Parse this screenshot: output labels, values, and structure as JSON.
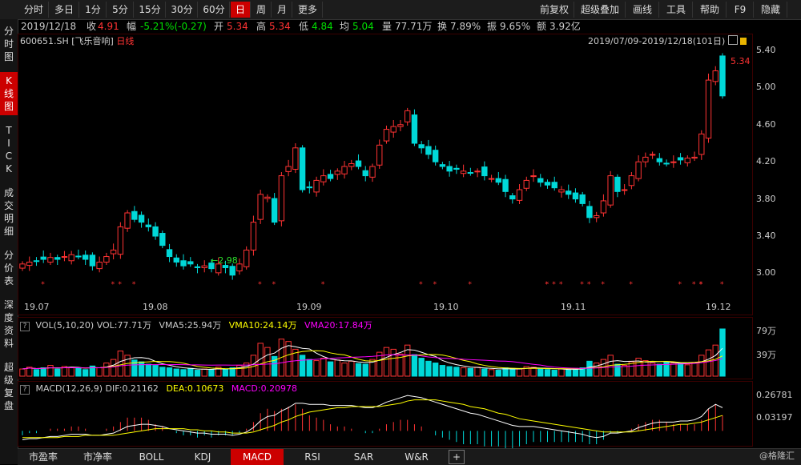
{
  "toolbar": {
    "left": [
      "分时",
      "多日",
      "1分",
      "5分",
      "15分",
      "30分",
      "60分",
      "日",
      "周",
      "月",
      "更多"
    ],
    "active": "日",
    "right": [
      "前复权",
      "超级叠加",
      "画线",
      "工具",
      "帮助",
      "F9",
      "隐藏"
    ]
  },
  "quote": {
    "date": "2019/12/18",
    "close_label": "收",
    "close": "4.91",
    "change_label": "幅",
    "change": "-5.21%(-0.27)",
    "open_label": "开",
    "open": "5.34",
    "high_label": "高",
    "high": "5.34",
    "low_label": "低",
    "low": "4.84",
    "avg_label": "均",
    "avg": "5.04",
    "volume_label": "量",
    "volume": "77.71万",
    "turnover_label": "换",
    "turnover": "7.89%",
    "amplitude_label": "振",
    "amplitude": "9.65%",
    "amount_label": "额",
    "amount": "3.92亿"
  },
  "security": {
    "code": "600651.SH",
    "name": "[飞乐音响]",
    "period": "日线"
  },
  "range_label": "2019/07/09-2019/12/18(101日)",
  "sidebar": [
    "分时图",
    "K线图",
    "TICK",
    "成交明细",
    "分价表",
    "深度资料",
    "超级复盘"
  ],
  "sidebar_active": 1,
  "price_axis": [
    "5.40",
    "5.00",
    "4.60",
    "4.20",
    "3.80",
    "3.40",
    "3.00"
  ],
  "volume_axis": [
    "79万",
    "39万"
  ],
  "macd_axis": [
    "0.26781",
    "0.03197"
  ],
  "x_axis": [
    "19.07",
    "19.08",
    "19.09",
    "19.10",
    "19.11",
    "19.12"
  ],
  "annotations": {
    "high": "5.34",
    "low": "2.98"
  },
  "vol_indicator": {
    "title": "VOL(5,10,20)",
    "vol": "VOL:77.71万",
    "vma5": "VMA5:25.94万",
    "vma10": "VMA10:24.14万",
    "vma20": "VMA20:17.84万"
  },
  "macd_indicator": {
    "title": "MACD(12,26,9)",
    "dif": "DIF:0.21162",
    "dea": "DEA:0.10673",
    "macd": "MACD:0.20978"
  },
  "bottom_tabs": [
    "市盈率",
    "市净率",
    "BOLL",
    "KDJ",
    "MACD",
    "RSI",
    "SAR",
    "W&R"
  ],
  "bottom_active": "MACD",
  "watermark": "@格隆汇",
  "colors": {
    "up": "#ff3333",
    "down": "#00d8d8",
    "active": "#cc0000",
    "vma5": "#ffffff",
    "vma10": "#ffff00",
    "vma20": "#ff00ff"
  },
  "chart_data": {
    "type": "candlestick",
    "closes": [
      3.1,
      3.12,
      3.13,
      3.15,
      3.17,
      3.15,
      3.18,
      3.2,
      3.18,
      3.15,
      3.08,
      3.12,
      3.18,
      3.25,
      3.5,
      3.65,
      3.58,
      3.55,
      3.5,
      3.4,
      3.3,
      3.18,
      3.12,
      3.08,
      3.1,
      3.06,
      3.08,
      3.05,
      3.1,
      3.06,
      2.98,
      3.1,
      3.25,
      3.55,
      3.85,
      3.82,
      3.55,
      4.05,
      4.15,
      4.35,
      3.9,
      3.92,
      4.0,
      4.05,
      4.02,
      4.1,
      4.15,
      4.18,
      4.15,
      4.05,
      4.15,
      4.38,
      4.55,
      4.58,
      4.6,
      4.75,
      4.4,
      4.35,
      4.28,
      4.2,
      4.15,
      4.1,
      4.12,
      4.1,
      4.08,
      4.1,
      4.05,
      4.02,
      3.98,
      3.88,
      3.8,
      3.9,
      4.0,
      4.05,
      3.98,
      3.95,
      3.92,
      3.9,
      3.85,
      3.8,
      3.75,
      3.6,
      3.62,
      3.78,
      4.05,
      3.88,
      3.9,
      4.05,
      4.2,
      4.25,
      4.28,
      4.2,
      4.18,
      4.2,
      4.22,
      4.24,
      4.25,
      4.5,
      5.08,
      5.18,
      4.91
    ],
    "volumes": [
      12,
      15,
      11,
      14,
      18,
      12,
      16,
      15,
      13,
      11,
      17,
      14,
      22,
      28,
      42,
      35,
      27,
      24,
      20,
      18,
      15,
      14,
      12,
      11,
      13,
      10,
      12,
      11,
      15,
      12,
      14,
      18,
      22,
      35,
      55,
      48,
      33,
      62,
      58,
      45,
      35,
      28,
      26,
      30,
      24,
      27,
      22,
      25,
      21,
      20,
      28,
      40,
      48,
      45,
      37,
      52,
      36,
      30,
      25,
      22,
      18,
      16,
      15,
      14,
      13,
      15,
      12,
      11,
      10,
      14,
      13,
      12,
      16,
      15,
      12,
      11,
      10,
      12,
      11,
      13,
      14,
      25,
      22,
      28,
      35,
      20,
      18,
      24,
      30,
      26,
      22,
      20,
      24,
      22,
      21,
      19,
      23,
      35,
      44,
      52,
      79
    ],
    "price_range": [
      2.84,
      5.46
    ],
    "dif": [
      -0.08,
      -0.07,
      -0.07,
      -0.06,
      -0.05,
      -0.05,
      -0.04,
      -0.03,
      -0.03,
      -0.03,
      -0.04,
      -0.04,
      -0.03,
      -0.02,
      0.01,
      0.04,
      0.05,
      0.06,
      0.06,
      0.05,
      0.04,
      0.02,
      0.01,
      0.0,
      -0.01,
      -0.02,
      -0.02,
      -0.03,
      -0.03,
      -0.03,
      -0.04,
      -0.03,
      -0.01,
      0.03,
      0.09,
      0.13,
      0.14,
      0.18,
      0.21,
      0.25,
      0.25,
      0.24,
      0.24,
      0.24,
      0.23,
      0.23,
      0.23,
      0.23,
      0.22,
      0.21,
      0.21,
      0.23,
      0.26,
      0.28,
      0.3,
      0.32,
      0.31,
      0.3,
      0.28,
      0.26,
      0.24,
      0.22,
      0.2,
      0.18,
      0.16,
      0.15,
      0.13,
      0.11,
      0.09,
      0.07,
      0.05,
      0.04,
      0.04,
      0.04,
      0.03,
      0.02,
      0.01,
      0.0,
      -0.01,
      -0.02,
      -0.03,
      -0.05,
      -0.06,
      -0.05,
      -0.02,
      -0.02,
      -0.01,
      0.0,
      0.03,
      0.05,
      0.07,
      0.08,
      0.08,
      0.08,
      0.09,
      0.09,
      0.1,
      0.13,
      0.2,
      0.24,
      0.21
    ],
    "dea": [
      -0.06,
      -0.06,
      -0.06,
      -0.06,
      -0.06,
      -0.06,
      -0.05,
      -0.05,
      -0.05,
      -0.04,
      -0.04,
      -0.04,
      -0.04,
      -0.04,
      -0.03,
      -0.02,
      -0.01,
      0.0,
      0.01,
      0.02,
      0.02,
      0.02,
      0.02,
      0.02,
      0.01,
      0.01,
      0.0,
      0.0,
      -0.01,
      -0.01,
      -0.02,
      -0.02,
      -0.02,
      -0.01,
      0.01,
      0.03,
      0.05,
      0.08,
      0.1,
      0.13,
      0.15,
      0.17,
      0.18,
      0.19,
      0.2,
      0.21,
      0.21,
      0.22,
      0.22,
      0.22,
      0.22,
      0.22,
      0.23,
      0.24,
      0.25,
      0.27,
      0.28,
      0.28,
      0.28,
      0.28,
      0.27,
      0.26,
      0.25,
      0.24,
      0.22,
      0.21,
      0.2,
      0.18,
      0.16,
      0.15,
      0.13,
      0.11,
      0.1,
      0.09,
      0.08,
      0.07,
      0.06,
      0.05,
      0.04,
      0.03,
      0.02,
      0.01,
      0.0,
      -0.01,
      -0.01,
      -0.01,
      -0.01,
      -0.01,
      0.0,
      0.01,
      0.02,
      0.03,
      0.04,
      0.05,
      0.06,
      0.06,
      0.07,
      0.08,
      0.1,
      0.12,
      0.14
    ],
    "macd_range": [
      -0.12,
      0.35
    ]
  }
}
